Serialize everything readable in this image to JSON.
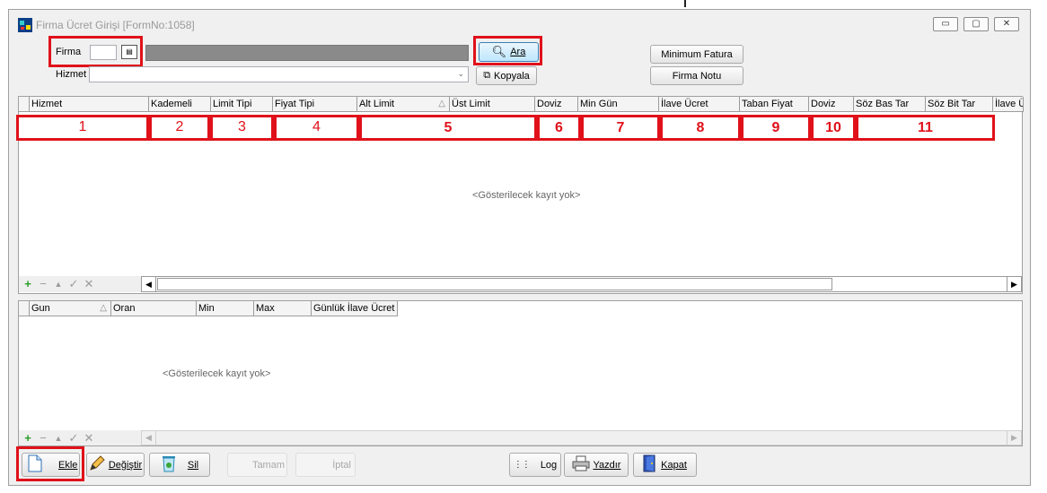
{
  "window": {
    "title": "Firma Ücret Girişi [FormNo:1058]",
    "controls": [
      "minimize-icon",
      "maximize-icon",
      "close-icon"
    ]
  },
  "form": {
    "firma_label": "Firma",
    "firma_value": "",
    "hizmet_label": "Hizmet",
    "hizmet_value": "",
    "ara_label": "Ara",
    "kopyala_label": "Kopyala",
    "min_fatura_label": "Minimum Fatura",
    "firma_notu_label": "Firma Notu"
  },
  "grid1": {
    "columns": [
      "Hizmet",
      "Kademeli",
      "Limit Tipi",
      "Fiyat Tipi",
      "Alt Limit",
      "Üst Limit",
      "Doviz",
      "Min Gün",
      "İlave Ücret",
      "Taban Fiyat",
      "Doviz",
      "Söz Bas Tar",
      "Söz Bit Tar",
      "İlave Ü"
    ],
    "annotations": [
      "1",
      "2",
      "3",
      "4",
      "5",
      "6",
      "7",
      "8",
      "9",
      "10",
      "11"
    ],
    "empty_text": "<Gösterilecek kayıt yok>"
  },
  "grid2": {
    "columns": [
      "Gun",
      "Oran",
      "Min",
      "Max",
      "Günlük İlave Ücret"
    ],
    "empty_text": "<Gösterilecek kayıt yok>"
  },
  "nav": {
    "icons": [
      "add-icon",
      "remove-icon",
      "up-icon",
      "check-icon",
      "cancel-icon"
    ]
  },
  "toolbar": {
    "ekle": "Ekle",
    "degistir": "Değiştir",
    "sil": "Sil",
    "tamam": "Tamam",
    "iptal": "İptal",
    "log": "Log",
    "yazdir": "Yazdır",
    "kapat": "Kapat"
  },
  "colors": {
    "highlight": "#e0111a",
    "window_bg": "#f0f0f0",
    "title_text": "#9a9a9a"
  }
}
